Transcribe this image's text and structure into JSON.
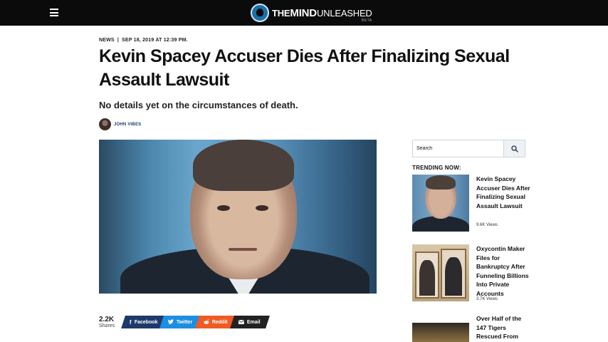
{
  "header": {
    "brand_the": "THE",
    "brand_mind": "MIND",
    "brand_unleashed": "UNLEASHED",
    "brand_beta": "BETA"
  },
  "article": {
    "category": "NEWS",
    "separator": "|",
    "date": "SEP 18, 2019 AT 12:39 PM.",
    "title": "Kevin Spacey Accuser Dies After Finalizing Sexual Assault Lawsuit",
    "subtitle": "No details yet on the circumstances of death.",
    "author": "JOHN VIBES"
  },
  "share": {
    "count": "2.2K",
    "count_label": "Shares",
    "buttons": [
      {
        "label": "Facebook",
        "icon": "facebook-icon",
        "color": "#1e3a6a"
      },
      {
        "label": "Twitter",
        "icon": "twitter-icon",
        "color": "#1d8fe0"
      },
      {
        "label": "Reddit",
        "icon": "reddit-icon",
        "color": "#f05a24"
      },
      {
        "label": "Email",
        "icon": "email-icon",
        "color": "#222222"
      }
    ]
  },
  "sidebar": {
    "search_placeholder": "Search",
    "trending_title": "TRENDING NOW:",
    "trending": [
      {
        "title": "Kevin Spacey Accuser Dies After Finalizing Sexual Assault Lawsuit",
        "views": "9.6K Views"
      },
      {
        "title": "Oxycontin Maker Files for Bankruptcy After Funneling Billions Into Private Accounts",
        "views": "3.7K Views"
      },
      {
        "title": "Over Half of the 147 Tigers Rescued From",
        "views": ""
      }
    ]
  }
}
